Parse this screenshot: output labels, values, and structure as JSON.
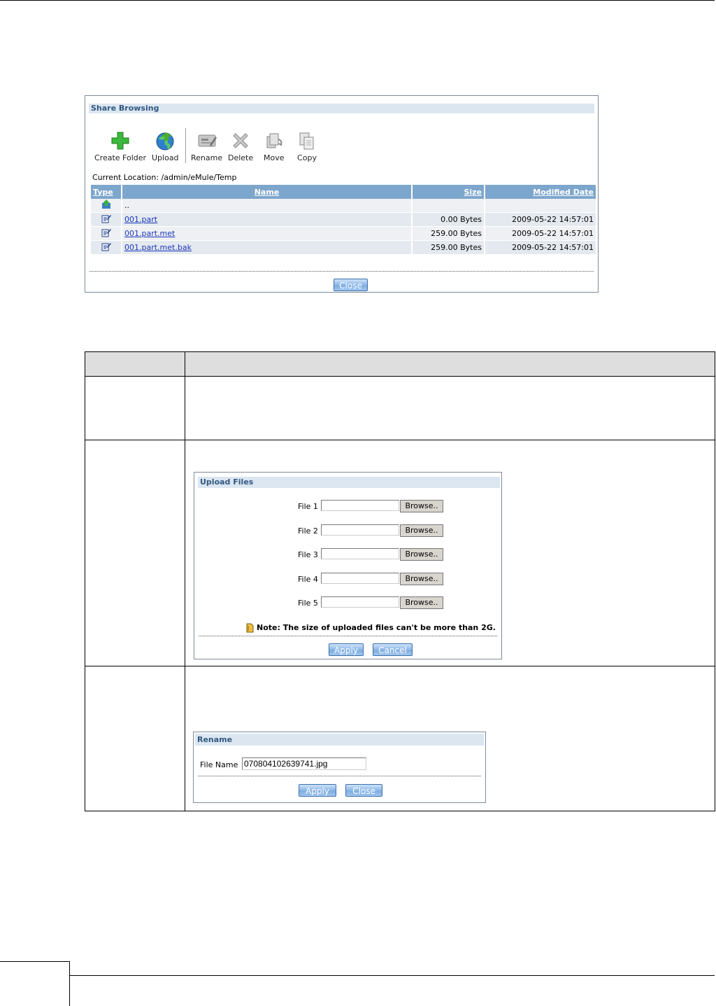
{
  "share_browsing": {
    "title": "Share Browsing",
    "toolbar": {
      "create_folder": "Create Folder",
      "upload": "Upload",
      "rename": "Rename",
      "delete": "Delete",
      "move": "Move",
      "copy": "Copy"
    },
    "current_location": "Current Location: /admin/eMule/Temp",
    "columns": {
      "type": "Type",
      "name": "Name",
      "size": "Size",
      "modified": "Modified Date"
    },
    "rows": [
      {
        "name": "..",
        "size": "",
        "modified": "",
        "icon": "parent-folder-icon"
      },
      {
        "name": "001.part",
        "size": "0.00 Bytes",
        "modified": "2009-05-22 14:57:01",
        "icon": "file-edit-icon"
      },
      {
        "name": "001.part.met",
        "size": "259.00 Bytes",
        "modified": "2009-05-22 14:57:01",
        "icon": "file-edit-icon"
      },
      {
        "name": "001.part.met.bak",
        "size": "259.00 Bytes",
        "modified": "2009-05-22 14:57:01",
        "icon": "file-edit-icon"
      }
    ],
    "close_label": "Close"
  },
  "upload_files": {
    "title": "Upload Files",
    "files": [
      {
        "label": "File 1",
        "browse": "Browse.."
      },
      {
        "label": "File 2",
        "browse": "Browse.."
      },
      {
        "label": "File 3",
        "browse": "Browse.."
      },
      {
        "label": "File 4",
        "browse": "Browse.."
      },
      {
        "label": "File 5",
        "browse": "Browse.."
      }
    ],
    "note": "Note: The size of uploaded files can't be more than 2G.",
    "apply_label": "Apply",
    "cancel_label": "Cancel"
  },
  "rename": {
    "title": "Rename",
    "field_label": "File Name",
    "field_value": "070804102639741.jpg",
    "apply_label": "Apply",
    "close_label": "Close"
  },
  "colors": {
    "panel_header_bg": "#dbe6f1",
    "panel_header_text": "#325881",
    "table_header_bg": "#7da6cc",
    "button_blue": "#7eaee2",
    "link": "#1a36b9",
    "desc_header_bg": "#dedede"
  }
}
